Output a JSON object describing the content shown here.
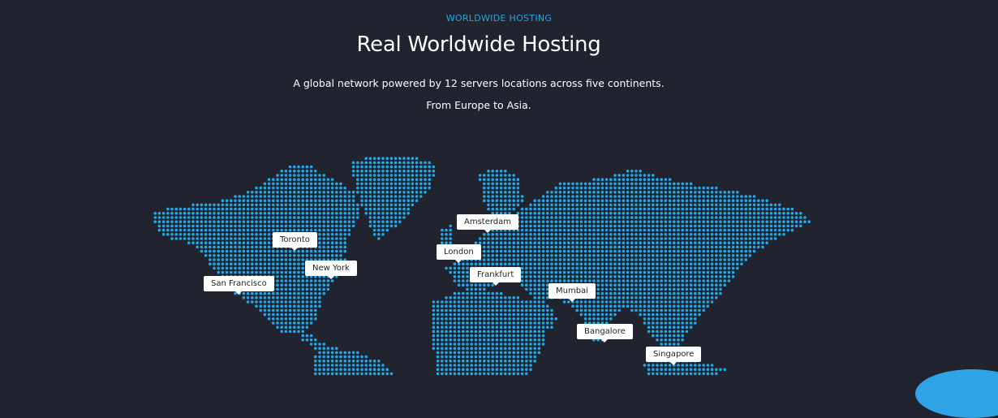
{
  "section": {
    "eyebrow": "WORLDWIDE HOSTING",
    "title": "Real Worldwide Hosting",
    "description": "A global network powered by 12 servers locations across five continents. From Europe to Asia."
  },
  "map": {
    "dot_color": "#1fa9e8",
    "background_color": "#21232f",
    "locations": [
      {
        "id": "san-francisco",
        "label": "San Francisco"
      },
      {
        "id": "toronto",
        "label": "Toronto"
      },
      {
        "id": "new-york",
        "label": "New York"
      },
      {
        "id": "london",
        "label": "London"
      },
      {
        "id": "amsterdam",
        "label": "Amsterdam"
      },
      {
        "id": "frankfurt",
        "label": "Frankfurt"
      },
      {
        "id": "mumbai",
        "label": "Mumbai"
      },
      {
        "id": "bangalore",
        "label": "Bangalore"
      },
      {
        "id": "singapore",
        "label": "Singapore"
      }
    ]
  }
}
